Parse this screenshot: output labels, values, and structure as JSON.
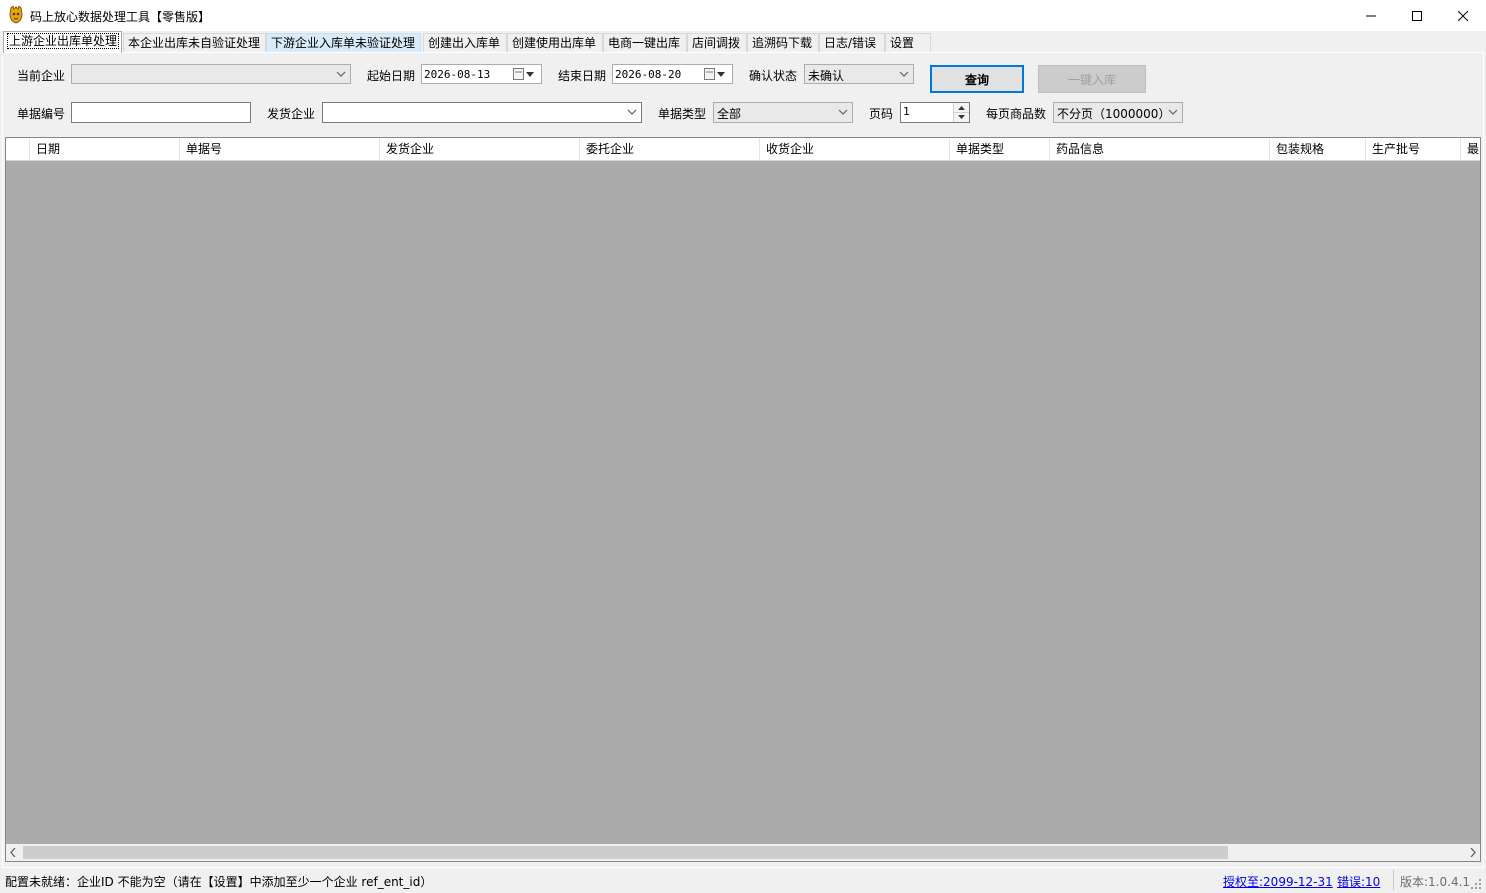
{
  "window": {
    "title": "码上放心数据处理工具【零售版】",
    "icon": "app-logo-icon"
  },
  "tabs": [
    {
      "label": "上游企业出库单处理"
    },
    {
      "label": "本企业出库未自验证处理"
    },
    {
      "label": "下游企业入库单未验证处理"
    },
    {
      "label": "创建出入库单"
    },
    {
      "label": "创建使用出库单"
    },
    {
      "label": "电商一键出库"
    },
    {
      "label": "店间调拨"
    },
    {
      "label": "追溯码下载"
    },
    {
      "label": "日志/错误"
    },
    {
      "label": "设置"
    }
  ],
  "form": {
    "current_enterprise_label": "当前企业",
    "current_enterprise_value": "",
    "start_date_label": "起始日期",
    "start_date_value": "2026-08-13",
    "end_date_label": "结束日期",
    "end_date_value": "2026-08-20",
    "confirm_status_label": "确认状态",
    "confirm_status_value": "未确认",
    "query_button": "查询",
    "one_click_in_button": "一键入库",
    "doc_no_label": "单据编号",
    "doc_no_value": "",
    "sender_label": "发货企业",
    "sender_value": "",
    "doc_type_label": "单据类型",
    "doc_type_value": "全部",
    "page_label": "页码",
    "page_value": "1",
    "per_page_label": "每页商品数",
    "per_page_value": "不分页（1000000）"
  },
  "grid": {
    "columns": [
      "日期",
      "单据号",
      "发货企业",
      "委托企业",
      "收货企业",
      "单据类型",
      "药品信息",
      "包装规格",
      "生产批号",
      "最"
    ],
    "rows": []
  },
  "status": {
    "message": "配置未就绪：企业ID 不能为空（请在【设置】中添加至少一个企业 ref_ent_id）",
    "license": "授权至:2099-12-31",
    "errors": "错误:10",
    "version": "版本:1.0.4.1"
  },
  "colors": {
    "grid_background": "#ababab",
    "link": "#0000ee",
    "tab_hover": "#d9ebf9",
    "default_button_border": "#0078d7"
  }
}
